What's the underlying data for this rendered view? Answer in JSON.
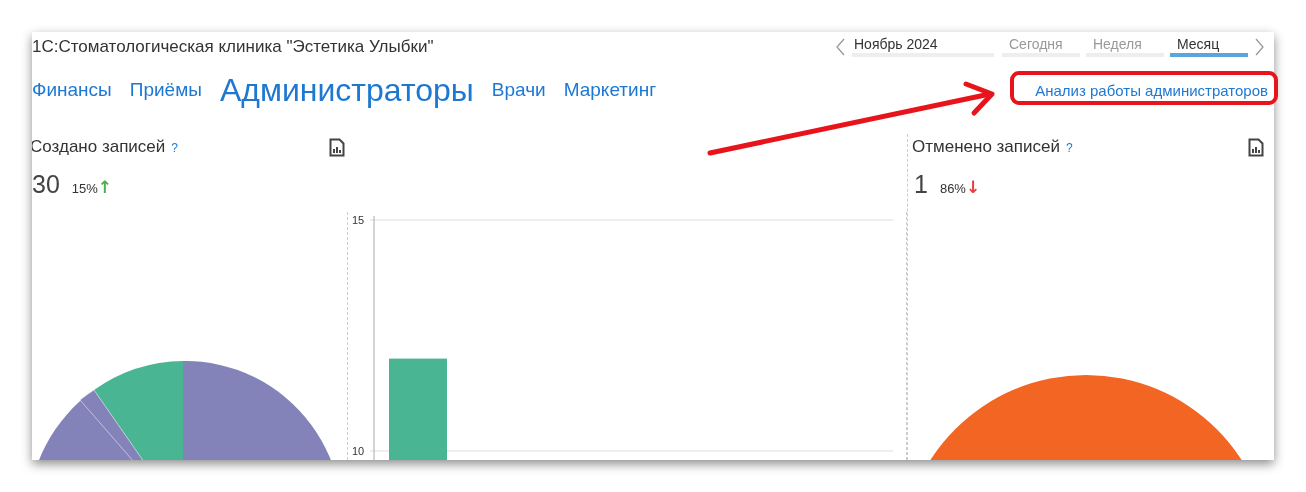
{
  "window": {
    "title": "1С:Стоматологическая клиника \"Эстетика Улыбки\""
  },
  "period": {
    "value": "Ноябрь 2024",
    "options": [
      {
        "label": "Сегодня",
        "selected": false
      },
      {
        "label": "Неделя",
        "selected": false
      },
      {
        "label": "Месяц",
        "selected": true
      }
    ]
  },
  "tabs": [
    {
      "label": "Финансы",
      "selected": false
    },
    {
      "label": "Приёмы",
      "selected": false
    },
    {
      "label": "Администраторы",
      "selected": true
    },
    {
      "label": "Врачи",
      "selected": false
    },
    {
      "label": "Маркетинг",
      "selected": false
    }
  ],
  "report_link": "Анализ работы администраторов",
  "created": {
    "title": "Создано записей",
    "help": "?",
    "value": "30",
    "change": "15%",
    "trend": "↑",
    "color": "#4caf50"
  },
  "chart": {
    "chart_data": {
      "type": "bar",
      "ylim": [
        0,
        15
      ],
      "yticks": [
        10,
        15
      ],
      "values": [
        12
      ]
    }
  },
  "cancelled": {
    "title": "Отменено записей",
    "help": "?",
    "value": "1",
    "change": "86%",
    "trend": "↓",
    "color": "#f03a3a"
  }
}
